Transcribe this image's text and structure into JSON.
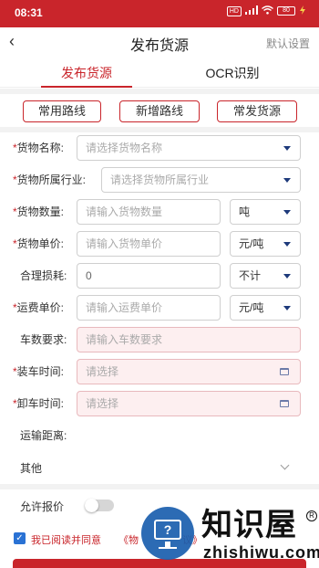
{
  "status_bar": {
    "time": "08:31",
    "icons": [
      "hd-icon",
      "signal-icon",
      "wifi-icon",
      "battery-icon"
    ],
    "battery_text": "80"
  },
  "nav": {
    "back_icon": "‹",
    "title": "发布货源",
    "right_action": "默认设置"
  },
  "tabs": [
    {
      "label": "发布货源",
      "active": true
    },
    {
      "label": "OCR识别",
      "active": false
    }
  ],
  "quick_buttons": [
    "常用路线",
    "新增路线",
    "常发货源"
  ],
  "form": {
    "cargo_name": {
      "label": "货物名称:",
      "placeholder": "请选择货物名称",
      "required": true
    },
    "industry": {
      "label": "货物所属行业:",
      "placeholder": "请选择货物所属行业",
      "required": true
    },
    "quantity": {
      "label": "货物数量:",
      "placeholder": "请输入货物数量",
      "unit": "吨",
      "required": true
    },
    "unit_price": {
      "label": "货物单价:",
      "placeholder": "请输入货物单价",
      "unit": "元/吨",
      "required": true
    },
    "loss": {
      "label": "合理损耗:",
      "value": "0",
      "unit": "不计",
      "required": false
    },
    "freight_price": {
      "label": "运费单价:",
      "placeholder": "请输入运费单价",
      "unit": "元/吨",
      "required": true
    },
    "vehicle_req": {
      "label": "车数要求:",
      "placeholder": "请输入车数要求",
      "required": false
    },
    "load_time": {
      "label": "装车时间:",
      "placeholder": "请选择",
      "required": true
    },
    "unload_time": {
      "label": "卸车时间:",
      "placeholder": "请选择",
      "required": true
    },
    "distance": {
      "label": "运输距离:"
    }
  },
  "other": {
    "label": "其他"
  },
  "allow_quote": {
    "label": "允许报价",
    "enabled": false
  },
  "agreement": {
    "checked": true,
    "text": "我已阅读并同意",
    "link": "《物",
    "link_tail": "议》"
  },
  "watermark": {
    "brand": "知识屋",
    "domain": "zhishiwu.com",
    "reg": "R"
  },
  "colors": {
    "brand_red": "#c9252b",
    "check_blue": "#2a72d4",
    "caret_navy": "#1e3a7b"
  }
}
